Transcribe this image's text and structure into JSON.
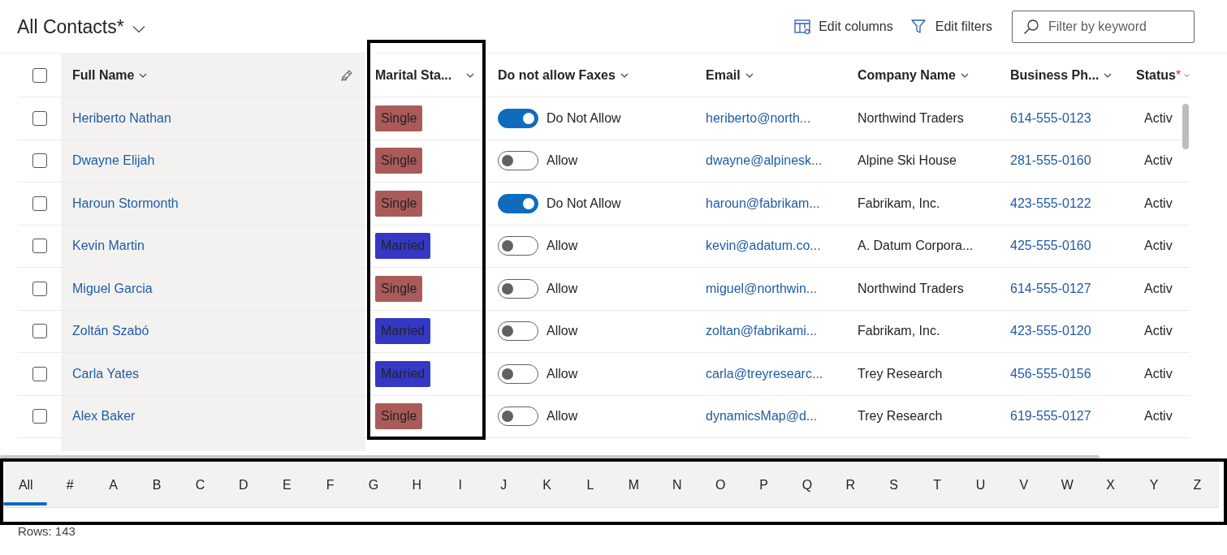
{
  "view": {
    "title": "All Contacts*"
  },
  "commands": [
    {
      "kind": "columns",
      "label": "Edit columns"
    },
    {
      "kind": "filters",
      "label": "Edit filters"
    }
  ],
  "search": {
    "placeholder": "Filter by keyword"
  },
  "table": {
    "columns": [
      {
        "label": "Full Name"
      },
      {
        "label": "Marital Sta..."
      },
      {
        "label": "Do not allow Faxes"
      },
      {
        "label": "Email"
      },
      {
        "label": "Company Name"
      },
      {
        "label": "Business Ph..."
      },
      {
        "label": "Status",
        "required_mark": "*"
      }
    ],
    "select_all_checked": false,
    "rows": [
      {
        "checked": false,
        "name": "Heriberto Nathan",
        "marital": "Single",
        "color": "#ab5a5a",
        "fax_on": true,
        "fax": "Do Not Allow",
        "email": "heriberto@north...",
        "company": "Northwind Traders",
        "phone": "614-555-0123",
        "status": "Activ"
      },
      {
        "checked": false,
        "name": "Dwayne Elijah",
        "marital": "Single",
        "color": "#ab5a5a",
        "fax_on": false,
        "fax": "Allow",
        "email": "dwayne@alpinesk...",
        "company": "Alpine Ski House",
        "phone": "281-555-0160",
        "status": "Activ"
      },
      {
        "checked": false,
        "name": "Haroun Stormonth",
        "marital": "Single",
        "color": "#ab5a5a",
        "fax_on": true,
        "fax": "Do Not Allow",
        "email": "haroun@fabrikam...",
        "company": "Fabrikam, Inc.",
        "phone": "423-555-0122",
        "status": "Activ"
      },
      {
        "checked": false,
        "name": "Kevin Martin",
        "marital": "Married",
        "color": "#3438c4",
        "fax_on": false,
        "fax": "Allow",
        "email": "kevin@adatum.co...",
        "company": "A. Datum Corpora...",
        "phone": "425-555-0160",
        "status": "Activ"
      },
      {
        "checked": false,
        "name": "Miguel Garcia",
        "marital": "Single",
        "color": "#ab5a5a",
        "fax_on": false,
        "fax": "Allow",
        "email": "miguel@northwin...",
        "company": "Northwind Traders",
        "phone": "614-555-0127",
        "status": "Activ"
      },
      {
        "checked": false,
        "name": "Zoltán Szabó",
        "marital": "Married",
        "color": "#3438c4",
        "fax_on": false,
        "fax": "Allow",
        "email": "zoltan@fabrikami...",
        "company": "Fabrikam, Inc.",
        "phone": "423-555-0120",
        "status": "Activ"
      },
      {
        "checked": false,
        "name": "Carla Yates",
        "marital": "Married",
        "color": "#3438c4",
        "fax_on": false,
        "fax": "Allow",
        "email": "carla@treyresearc...",
        "company": "Trey Research",
        "phone": "456-555-0156",
        "status": "Activ"
      },
      {
        "checked": false,
        "name": "Alex Baker",
        "marital": "Single",
        "color": "#ab5a5a",
        "fax_on": false,
        "fax": "Allow",
        "email": "dynamicsMap@d...",
        "company": "Trey Research",
        "phone": "619-555-0127",
        "status": "Activ"
      }
    ]
  },
  "jump_bar": [
    {
      "label": "All",
      "selected": true
    },
    {
      "label": "#",
      "selected": false
    },
    {
      "label": "A",
      "selected": false
    },
    {
      "label": "B",
      "selected": false
    },
    {
      "label": "C",
      "selected": false
    },
    {
      "label": "D",
      "selected": false
    },
    {
      "label": "E",
      "selected": false
    },
    {
      "label": "F",
      "selected": false
    },
    {
      "label": "G",
      "selected": false
    },
    {
      "label": "H",
      "selected": false
    },
    {
      "label": "I",
      "selected": false
    },
    {
      "label": "J",
      "selected": false
    },
    {
      "label": "K",
      "selected": false
    },
    {
      "label": "L",
      "selected": false
    },
    {
      "label": "M",
      "selected": false
    },
    {
      "label": "N",
      "selected": false
    },
    {
      "label": "O",
      "selected": false
    },
    {
      "label": "P",
      "selected": false
    },
    {
      "label": "Q",
      "selected": false
    },
    {
      "label": "R",
      "selected": false
    },
    {
      "label": "S",
      "selected": false
    },
    {
      "label": "T",
      "selected": false
    },
    {
      "label": "U",
      "selected": false
    },
    {
      "label": "V",
      "selected": false
    },
    {
      "label": "W",
      "selected": false
    },
    {
      "label": "X",
      "selected": false
    },
    {
      "label": "Y",
      "selected": false
    },
    {
      "label": "Z",
      "selected": false
    }
  ],
  "footer": {
    "row_count": "Rows: 143"
  }
}
